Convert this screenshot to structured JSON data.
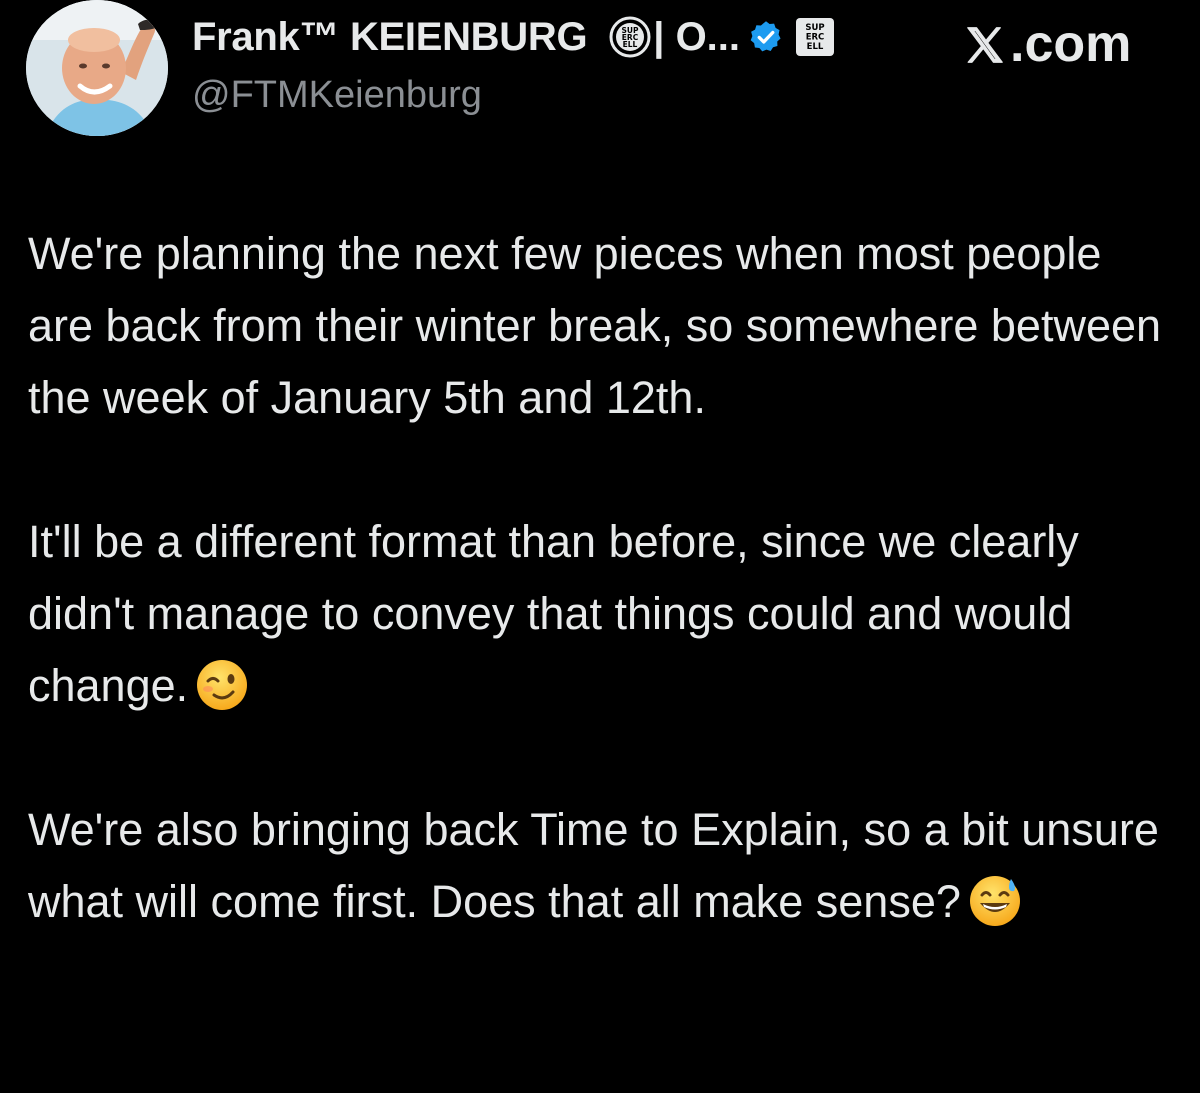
{
  "author": {
    "display_name": "Frank™ KEIENBURG",
    "name_suffix": "| O...",
    "handle": "@FTMKeienburg",
    "badge_icon": "supercell-circle-badge-icon",
    "verified_icon": "verified-checkmark-icon",
    "affiliate_icon": "supercell-affiliate-icon",
    "badge_text": [
      "SUP",
      "ERC",
      "ELL"
    ]
  },
  "brand": {
    "suffix": ".com",
    "icon": "x-logo-icon"
  },
  "tweet": {
    "paragraphs": [
      {
        "text": "We're planning the next few pieces when most people are back from their winter break, so somewhere between the week of January 5th and 12th.",
        "emoji": ""
      },
      {
        "text": "It'll be a different format than before, since we clearly didn't manage to convey that things could and would change.",
        "emoji": "winking-face-icon"
      },
      {
        "text": "We're also bringing back Time to Explain, so a bit unsure what will come first. Does that all make sense?",
        "emoji": "grinning-sweat-face-icon"
      }
    ]
  },
  "colors": {
    "background": "#000000",
    "text": "#e7e9ea",
    "secondary_text": "#8b8f94",
    "verified_blue": "#1d9bf0"
  }
}
